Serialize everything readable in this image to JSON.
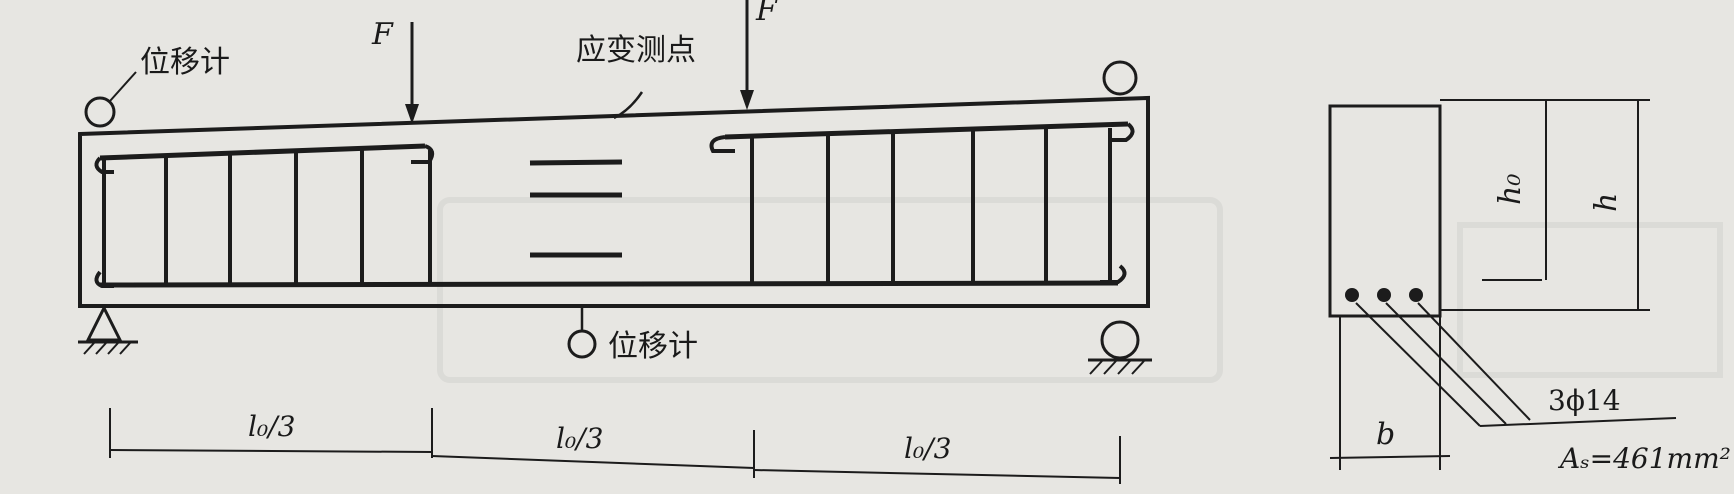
{
  "labels": {
    "force_left": "F",
    "force_right": "F",
    "gauge_top_left": "位移计",
    "gauge_mid": "位移计",
    "strain_points": "应变测点",
    "span_1": "l₀/3",
    "span_2": "l₀/3",
    "span_3": "l₀/3",
    "section_b": "b",
    "section_h": "h",
    "section_h0": "h₀",
    "rebar_spec": "3ϕ14",
    "rebar_area": "Aₛ=461mm²"
  },
  "colors": {
    "ink": "#1c1c1c",
    "paper": "#e7e6e2"
  }
}
